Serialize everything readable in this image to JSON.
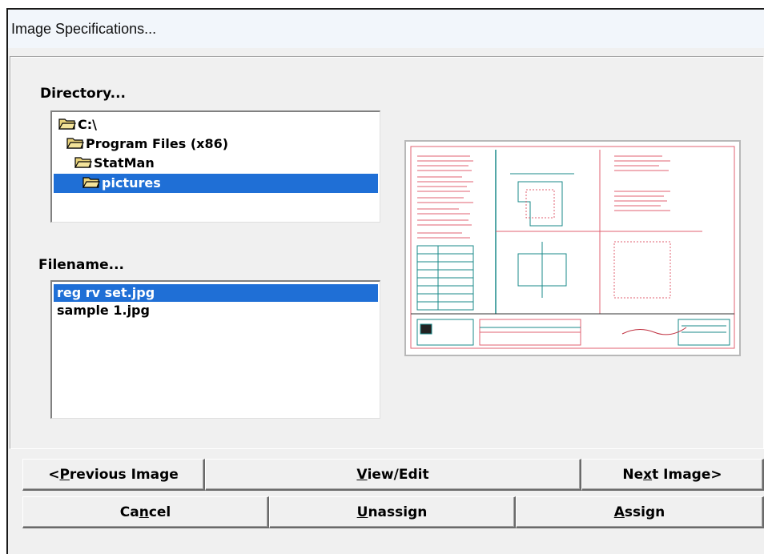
{
  "window": {
    "title": "Image Specifications..."
  },
  "directory": {
    "label": "Directory...",
    "items": [
      {
        "label": "C:\\"
      },
      {
        "label": "Program Files (x86)"
      },
      {
        "label": "StatMan"
      },
      {
        "label": "pictures",
        "selected": true
      }
    ]
  },
  "filename": {
    "label": "Filename...",
    "items": [
      {
        "label": "reg rv set.jpg",
        "selected": true
      },
      {
        "label": "sample 1.jpg"
      }
    ]
  },
  "buttons": {
    "previous": {
      "before": "<",
      "mnemonic": "P",
      "after": "revious Image"
    },
    "view_edit": {
      "before": "",
      "mnemonic": "V",
      "after": "iew/Edit"
    },
    "next": {
      "before": "Ne",
      "mnemonic": "x",
      "after": "t Image>"
    },
    "cancel": {
      "before": "Ca",
      "mnemonic": "n",
      "after": "cel"
    },
    "unassign": {
      "before": "",
      "mnemonic": "U",
      "after": "nassign"
    },
    "assign": {
      "before": "",
      "mnemonic": "A",
      "after": "ssign"
    }
  },
  "colors": {
    "selection": "#1f6fd6",
    "folder": "#e8d27a",
    "drawing_red": "#e06070",
    "drawing_teal": "#1a8a8a"
  }
}
